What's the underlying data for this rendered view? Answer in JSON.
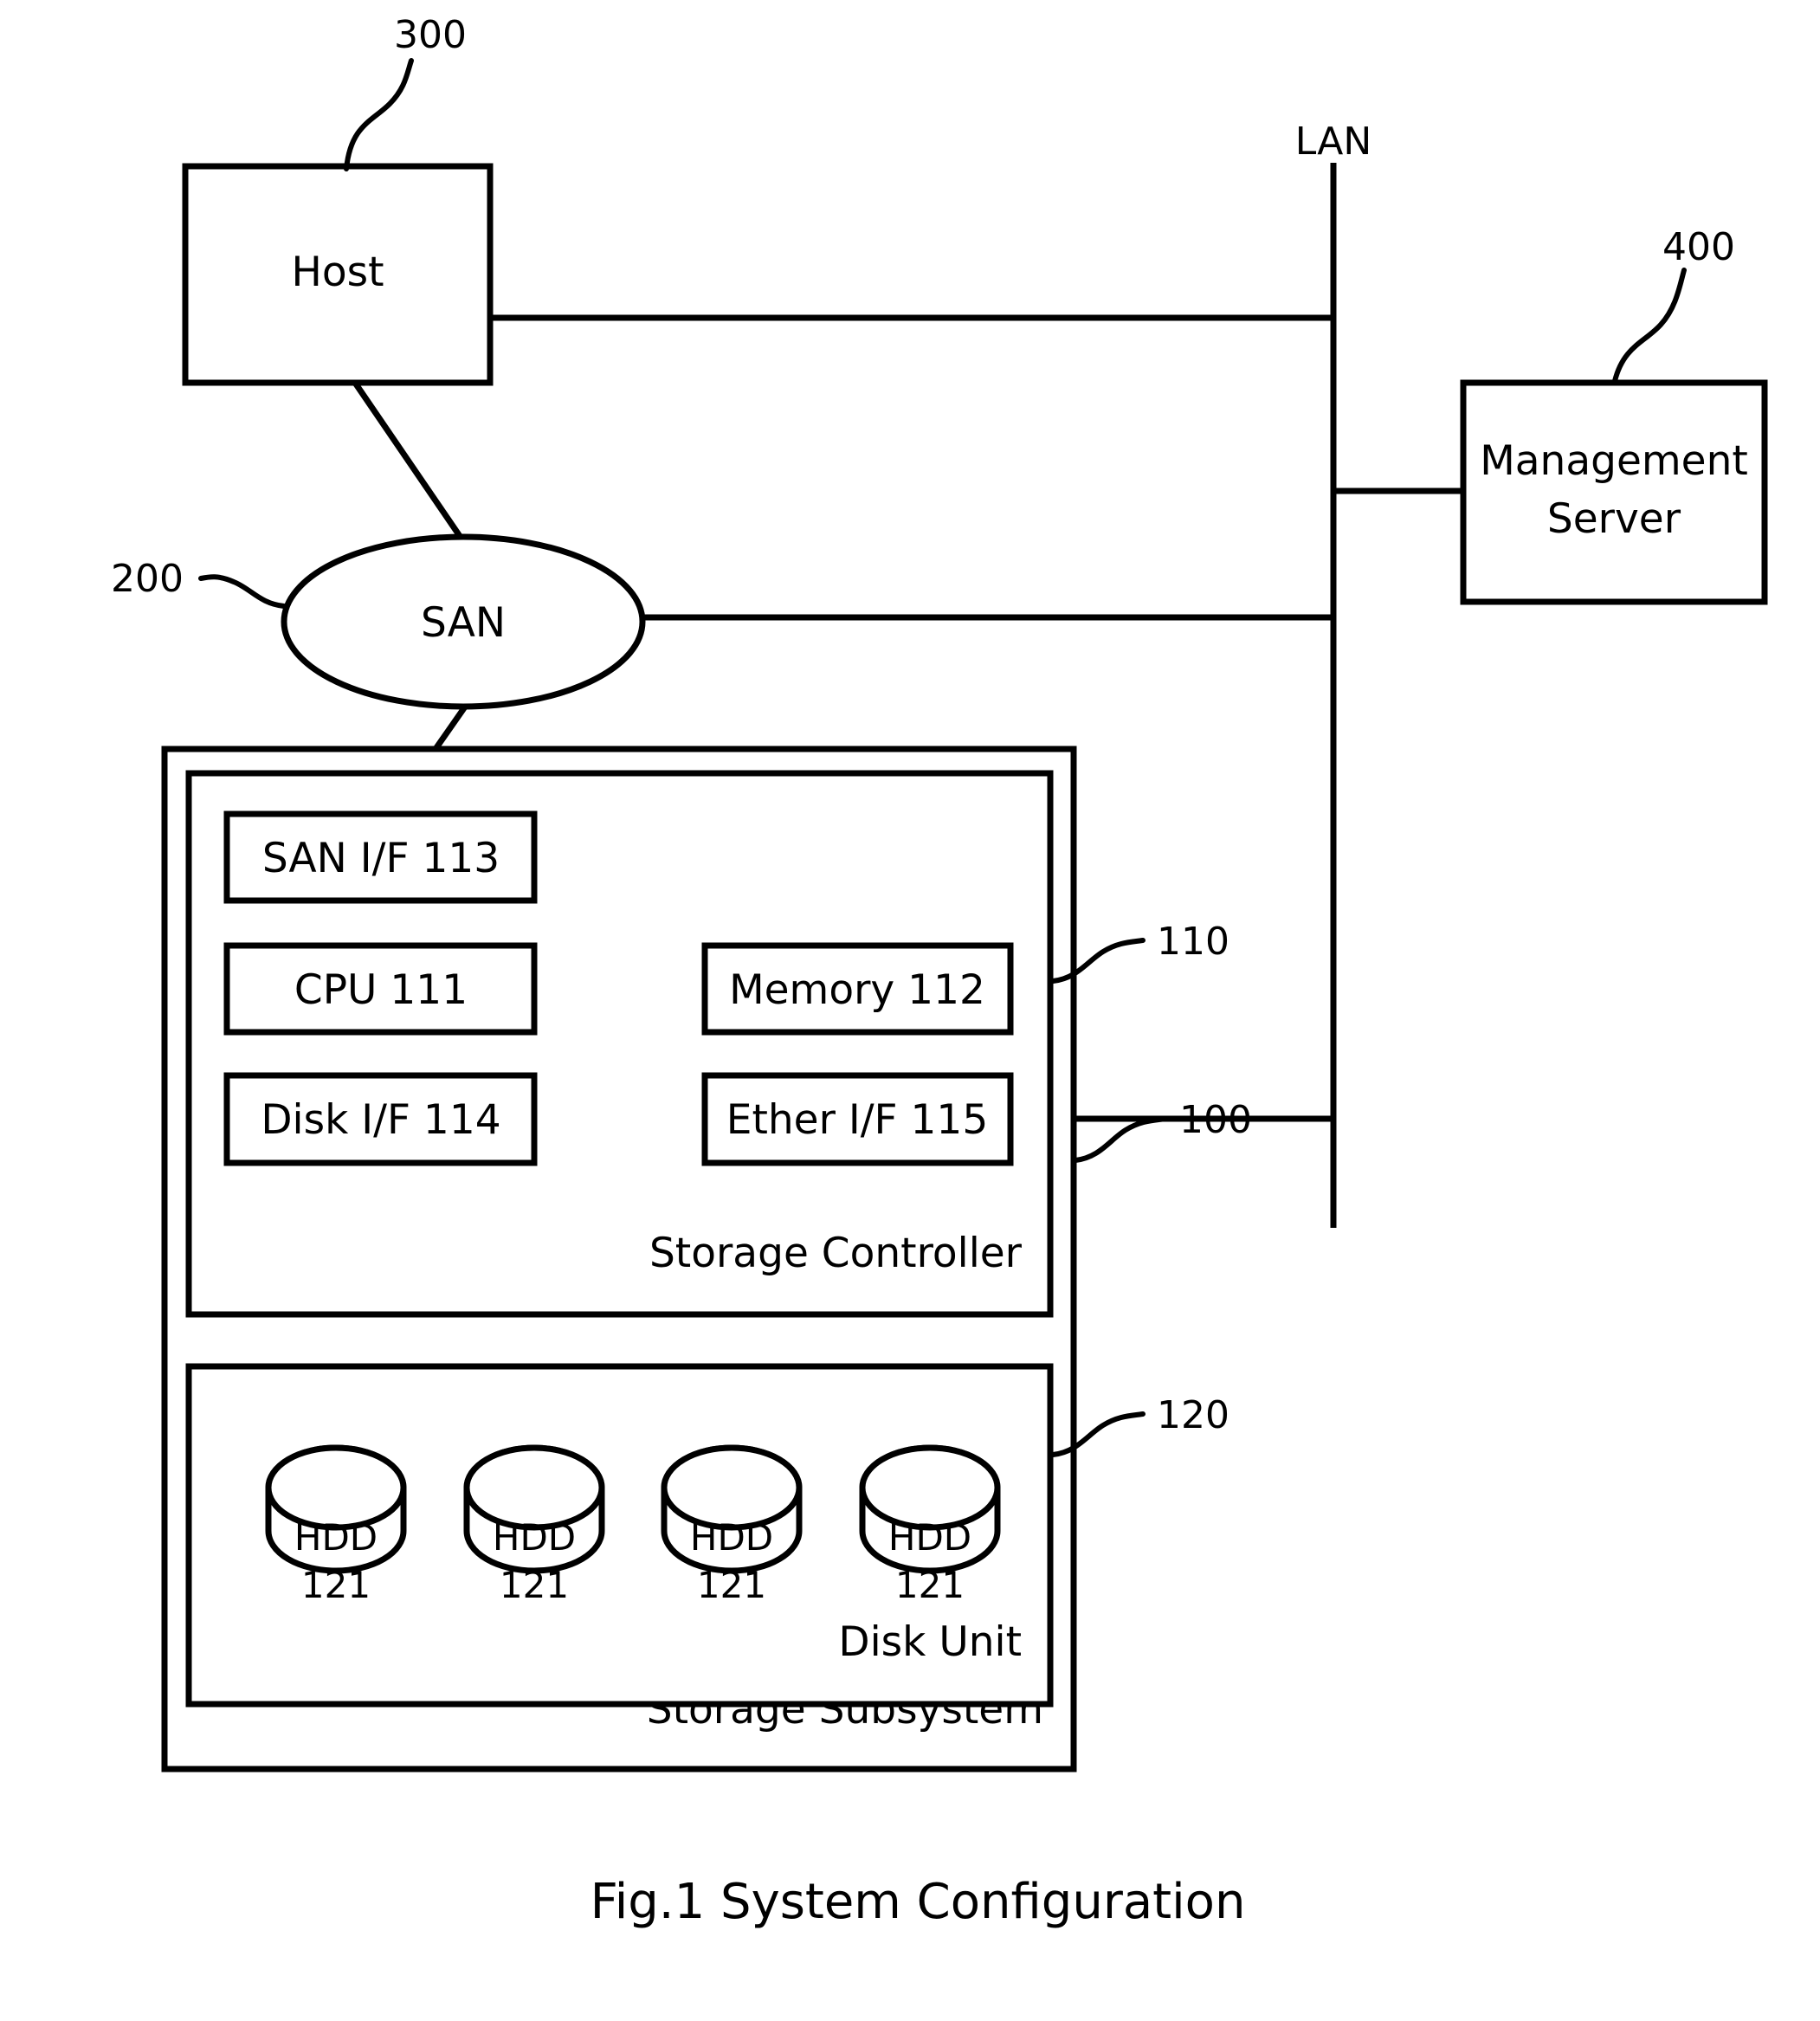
{
  "figure": {
    "caption": "Fig.1 System Configuration",
    "title": "System Configuration"
  },
  "nodes": {
    "host": {
      "label": "Host",
      "ref": "300"
    },
    "san": {
      "label": "SAN",
      "ref": "200"
    },
    "lan": {
      "label": "LAN"
    },
    "management_server": {
      "label_line1": "Management",
      "label_line2": "Server",
      "ref": "400"
    }
  },
  "storage_subsystem": {
    "label": "Storage Subsystem",
    "ref": "100",
    "controller": {
      "label": "Storage Controller",
      "ref": "110",
      "blocks": [
        {
          "label": "SAN I/F 113",
          "name": "san-if",
          "number": "113"
        },
        {
          "label": "CPU 111",
          "name": "cpu",
          "number": "111"
        },
        {
          "label": "Memory 112",
          "name": "memory",
          "number": "112"
        },
        {
          "label": "Disk I/F 114",
          "name": "disk-if",
          "number": "114"
        },
        {
          "label": "Ether I/F 115",
          "name": "ether-if",
          "number": "115"
        }
      ]
    },
    "disk_unit": {
      "label": "Disk Unit",
      "ref": "120",
      "disks": [
        {
          "line1": "HDD",
          "line2": "121"
        },
        {
          "line1": "HDD",
          "line2": "121"
        },
        {
          "line1": "HDD",
          "line2": "121"
        },
        {
          "line1": "HDD",
          "line2": "121"
        }
      ]
    }
  },
  "colors": {
    "stroke": "#000000",
    "background": "#ffffff"
  }
}
